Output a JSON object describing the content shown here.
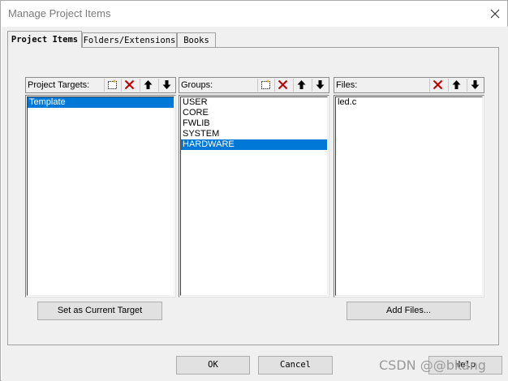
{
  "window": {
    "title": "Manage Project Items"
  },
  "tabs": [
    {
      "label": "Project Items",
      "active": true
    },
    {
      "label": "Folders/Extensions",
      "active": false
    },
    {
      "label": "Books",
      "active": false
    }
  ],
  "targets": {
    "label": "Project Targets:",
    "items": [
      {
        "text": "Template",
        "selected": true
      }
    ],
    "button": "Set as Current Target"
  },
  "groups": {
    "label": "Groups:",
    "items": [
      {
        "text": "USER",
        "selected": false
      },
      {
        "text": "CORE",
        "selected": false
      },
      {
        "text": "FWLIB",
        "selected": false
      },
      {
        "text": "SYSTEM",
        "selected": false
      },
      {
        "text": "HARDWARE",
        "selected": true
      }
    ]
  },
  "files": {
    "label": "Files:",
    "items": [
      {
        "text": "led.c",
        "selected": false
      }
    ],
    "button": "Add Files..."
  },
  "footer": {
    "ok": "OK",
    "cancel": "Cancel",
    "help": "Help"
  },
  "watermark": "CSDN @@bkang",
  "icons": [
    "close-icon",
    "new-item-icon",
    "delete-icon",
    "move-up-icon",
    "move-down-icon"
  ],
  "colors": {
    "selection": "#0078d7",
    "dialog_bg": "#f0f0f0",
    "delete_red": "#c00000"
  }
}
